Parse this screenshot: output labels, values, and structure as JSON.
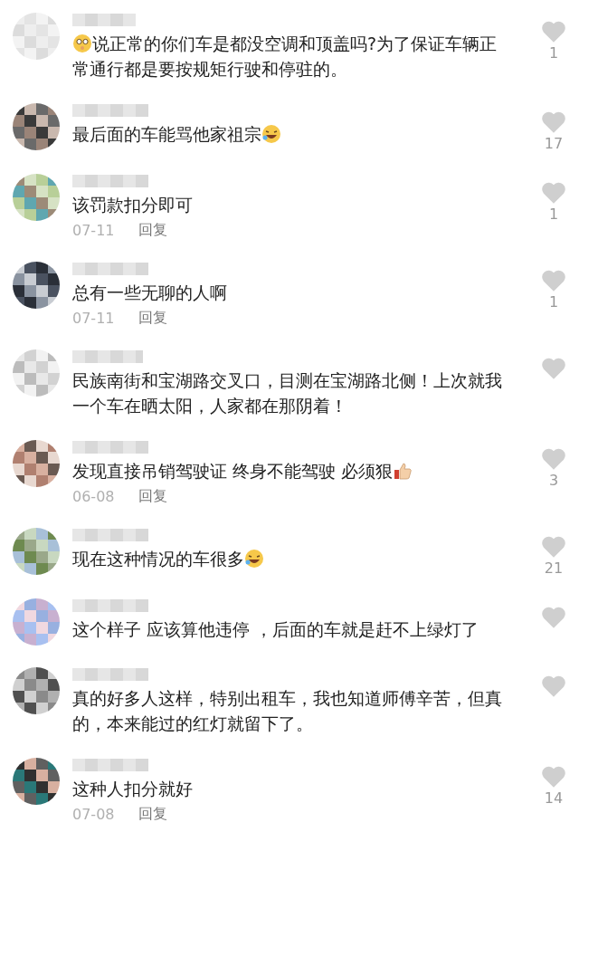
{
  "comments": [
    {
      "text": "说正常的你们车是都没空调和顶盖吗?为了保证车辆正常通行都是要按规矩行驶和停驻的。",
      "emoji_lead": {
        "kind": "pleading"
      },
      "likes": "1"
    },
    {
      "text": "最后面的车能骂他家祖宗",
      "emoji_trail": {
        "kind": "laughing"
      },
      "likes": "17"
    },
    {
      "text": "该罚款扣分即可",
      "likes": "1",
      "date": "07-11",
      "reply": "回复"
    },
    {
      "text": "总有一些无聊的人啊",
      "likes": "1",
      "date": "07-11",
      "reply": "回复"
    },
    {
      "text": "民族南街和宝湖路交叉口，目测在宝湖路北侧！上次就我一个车在晒太阳，人家都在那阴着！"
    },
    {
      "text": "发现直接吊销驾驶证 终身不能驾驶 必须狠",
      "emoji_trail": {
        "kind": "thumbs-up"
      },
      "likes": "3",
      "date": "06-08",
      "reply": "回复"
    },
    {
      "text": "现在这种情况的车很多",
      "emoji_trail": {
        "kind": "laughing"
      },
      "likes": "21"
    },
    {
      "text": "这个样子 应该算他违停 ，后面的车就是赶不上绿灯了"
    },
    {
      "text": "真的好多人这样，特别出租车，我也知道师傅辛苦，但真的，本来能过的红灯就留下了。"
    },
    {
      "text": "这种人扣分就好",
      "likes": "14",
      "date": "07-08",
      "reply": "回复"
    }
  ]
}
